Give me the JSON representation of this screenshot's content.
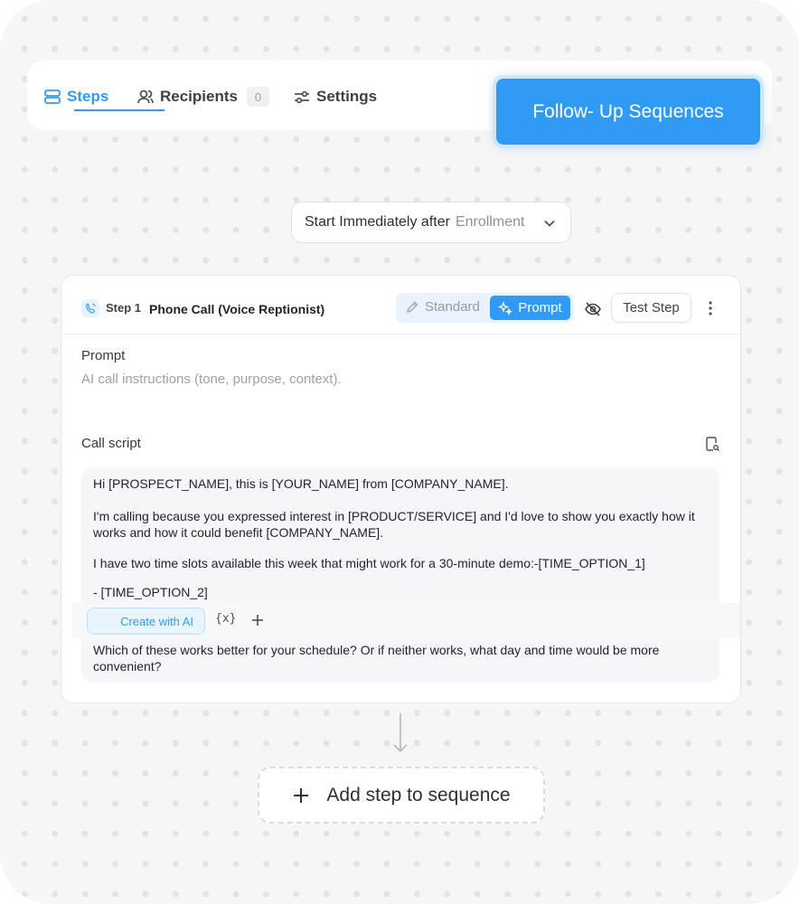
{
  "nav": {
    "tabs": [
      {
        "label": "Steps",
        "icon": "layers-icon",
        "active": true
      },
      {
        "label": "Recipients",
        "icon": "users-icon",
        "count": "0"
      },
      {
        "label": "Settings",
        "icon": "sliders-icon"
      }
    ]
  },
  "brand_button": "Follow- Up Sequences",
  "trigger": {
    "prefix": "Start Immediately after",
    "value": "Enrollment"
  },
  "step": {
    "label": "Step 1",
    "title": "Phone Call (Voice Reptionist)",
    "mode_standard": "Standard",
    "mode_prompt": "Prompt",
    "test_button": "Test Step",
    "prompt_label": "Prompt",
    "prompt_placeholder": "AI call instructions (tone, purpose, context).",
    "script_label": "Call script",
    "script_lines": [
      "Hi [PROSPECT_NAME], this is [YOUR_NAME] from [COMPANY_NAME].",
      "I'm calling because you expressed interest in [PRODUCT/SERVICE] and I'd love to show you exactly how it",
      "works and how it could benefit [COMPANY_NAME].",
      "I have two time slots available this week that might work for a 30-minute demo:-[TIME_OPTION_1]",
      "- [TIME_OPTION_2]",
      "Which of these works better for your schedule? Or if neither works, what day and time would be more",
      "convenient?"
    ],
    "create_ai": "Create with AI",
    "variable_button": "{x}"
  },
  "add_step": "Add step to sequence",
  "colors": {
    "accent": "#2f9bf5",
    "background": "#f6f6f7"
  }
}
